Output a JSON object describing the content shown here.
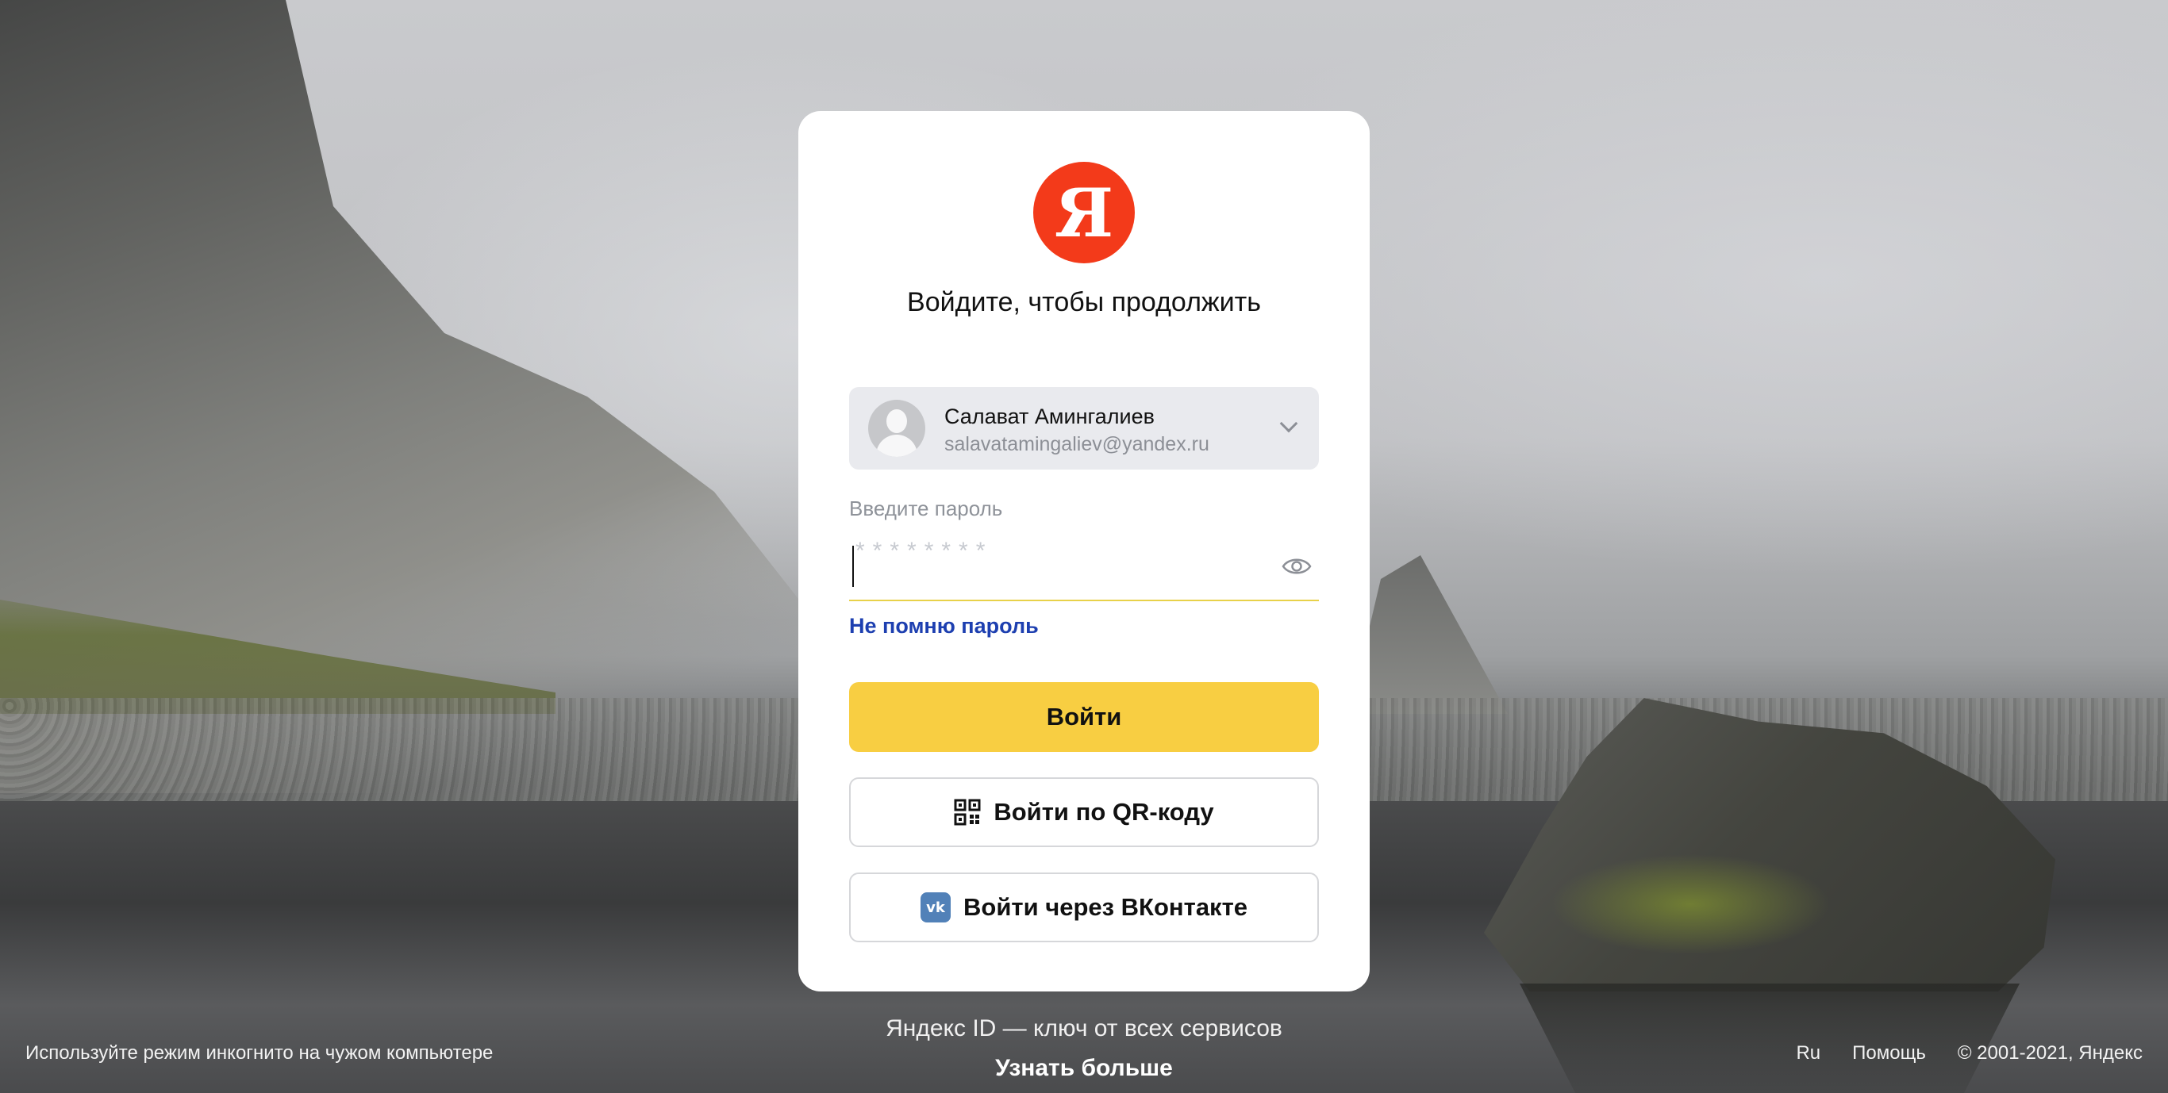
{
  "card": {
    "logo_letter": "Я",
    "title": "Войдите, чтобы продолжить",
    "account": {
      "name": "Салават Амингалиев",
      "email": "salavatamingaliev@yandex.ru"
    },
    "password": {
      "label": "Введите пароль",
      "placeholder": "********"
    },
    "forgot_label": "Не помню пароль",
    "login_button": "Войти",
    "qr_button": "Войти по QR-коду",
    "vk_button": "Войти через ВКонтакте",
    "vk_icon_text": "vk"
  },
  "promo": {
    "tagline": "Яндекс ID — ключ от всех сервисов",
    "learn_more": "Узнать больше"
  },
  "footer": {
    "incognito_hint": "Используйте режим инкогнито на чужом компьютере",
    "language": "Ru",
    "help": "Помощь",
    "copyright": "© 2001-2021, Яндекс"
  },
  "colors": {
    "brand_red": "#f33a1a",
    "primary_yellow": "#f8ce42",
    "link_blue": "#1d3fb0",
    "vk_blue": "#5181b8"
  },
  "icons": {
    "logo": "yandex-logo-icon",
    "chevron": "chevron-down-icon",
    "eye": "eye-icon",
    "qr": "qr-code-icon",
    "vk": "vk-icon"
  }
}
